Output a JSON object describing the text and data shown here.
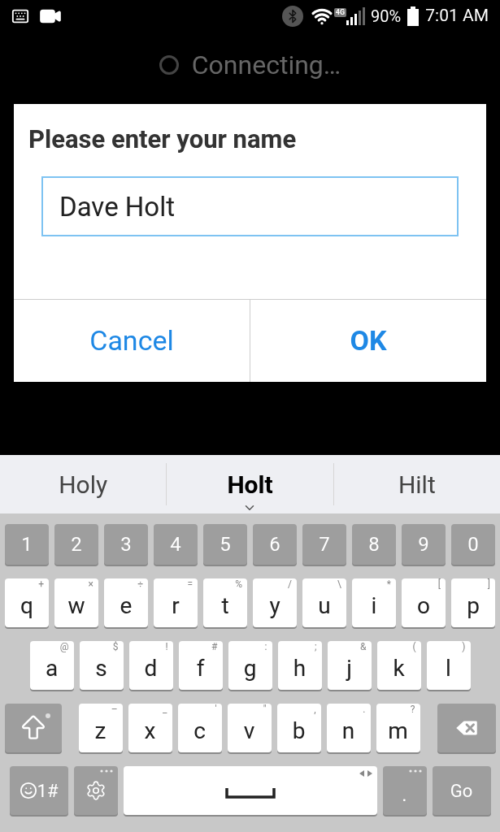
{
  "status_bar": {
    "network": "4G",
    "battery": "90%",
    "time": "7:01 AM"
  },
  "header": {
    "title": "Connecting…"
  },
  "dialog": {
    "title": "Please enter your name",
    "input": {
      "value": "Dave Holt"
    },
    "buttons": [
      {
        "label": "Cancel",
        "kind": "cancel"
      },
      {
        "label": "OK",
        "kind": "ok"
      }
    ]
  },
  "suggestions": [
    {
      "text": "Holy",
      "selected": false
    },
    {
      "text": "Holt",
      "selected": true
    },
    {
      "text": "Hilt",
      "selected": false
    }
  ],
  "keyboard": {
    "rows": [
      [
        {
          "kind": "number",
          "label": "1"
        },
        {
          "kind": "number",
          "label": "2"
        },
        {
          "kind": "number",
          "label": "3"
        },
        {
          "kind": "number",
          "label": "4"
        },
        {
          "kind": "number",
          "label": "5"
        },
        {
          "kind": "number",
          "label": "6"
        },
        {
          "kind": "number",
          "label": "7"
        },
        {
          "kind": "number",
          "label": "8"
        },
        {
          "kind": "number",
          "label": "9"
        },
        {
          "kind": "number",
          "label": "0"
        }
      ],
      [
        {
          "kind": "letter",
          "label": "q",
          "hint": "+"
        },
        {
          "kind": "letter",
          "label": "w",
          "hint": "×"
        },
        {
          "kind": "letter",
          "label": "e",
          "hint": "÷"
        },
        {
          "kind": "letter",
          "label": "r",
          "hint": "="
        },
        {
          "kind": "letter",
          "label": "t",
          "hint": "%"
        },
        {
          "kind": "letter",
          "label": "y",
          "hint": "/"
        },
        {
          "kind": "letter",
          "label": "u",
          "hint": "\\"
        },
        {
          "kind": "letter",
          "label": "i",
          "hint": "*"
        },
        {
          "kind": "letter",
          "label": "o",
          "hint": "["
        },
        {
          "kind": "letter",
          "label": "p",
          "hint": "]"
        }
      ],
      [
        {
          "kind": "letter",
          "label": "a",
          "hint": "@"
        },
        {
          "kind": "letter",
          "label": "s",
          "hint": "$"
        },
        {
          "kind": "letter",
          "label": "d",
          "hint": "!"
        },
        {
          "kind": "letter",
          "label": "f",
          "hint": "#"
        },
        {
          "kind": "letter",
          "label": "g",
          "hint": ":"
        },
        {
          "kind": "letter",
          "label": "h",
          "hint": ";"
        },
        {
          "kind": "letter",
          "label": "j",
          "hint": "&"
        },
        {
          "kind": "letter",
          "label": "k",
          "hint": "("
        },
        {
          "kind": "letter",
          "label": "l",
          "hint": ")"
        }
      ],
      [
        {
          "kind": "shift"
        },
        {
          "kind": "letter",
          "label": "z",
          "hint": "–"
        },
        {
          "kind": "letter",
          "label": "x",
          "hint": "_"
        },
        {
          "kind": "letter",
          "label": "c",
          "hint": "'"
        },
        {
          "kind": "letter",
          "label": "v",
          "hint": "\""
        },
        {
          "kind": "letter",
          "label": "b",
          "hint": ","
        },
        {
          "kind": "letter",
          "label": "n",
          "hint": "."
        },
        {
          "kind": "letter",
          "label": "m",
          "hint": "?"
        },
        {
          "kind": "backspace"
        }
      ],
      [
        {
          "kind": "symbols",
          "label": "1#"
        },
        {
          "kind": "settings"
        },
        {
          "kind": "space"
        },
        {
          "kind": "period",
          "label": "."
        },
        {
          "kind": "go",
          "label": "Go"
        }
      ]
    ]
  }
}
